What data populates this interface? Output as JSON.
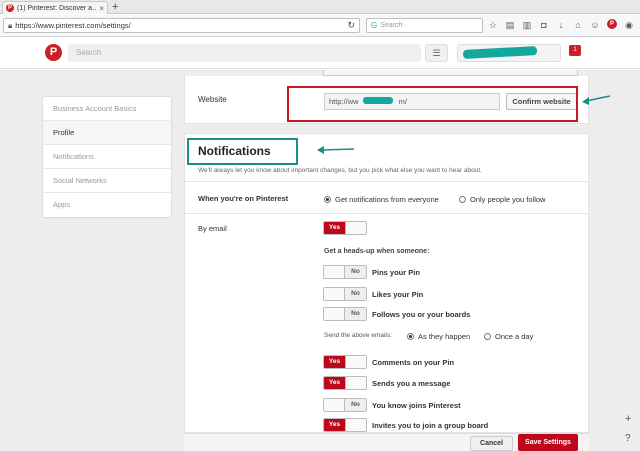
{
  "browser": {
    "tab_title": "(1) Pinterest: Discover a…",
    "tab_close": "×",
    "new_tab": "+",
    "url": "https://www.pinterest.com/settings/",
    "search_placeholder": "Search",
    "search_engine_icon": "G"
  },
  "header": {
    "logo": "P",
    "search_placeholder": "Search",
    "menu_icon": "☰",
    "notification_count": "1"
  },
  "sidebar": {
    "items": [
      {
        "label": "Business Account Basics"
      },
      {
        "label": "Profile"
      },
      {
        "label": "Notifications"
      },
      {
        "label": "Social Networks"
      },
      {
        "label": "Apps"
      }
    ]
  },
  "website": {
    "label": "Website",
    "value_prefix": "http://ww",
    "value_suffix": "m/",
    "confirm_button": "Confirm website"
  },
  "notifications": {
    "title": "Notifications",
    "subtitle": "We'll always let you know about important changes, but you pick what else you want to hear about.",
    "on_pinterest": {
      "label": "When you're on Pinterest",
      "option1": "Get notifications from everyone",
      "option2": "Only people you follow"
    },
    "by_email": {
      "label": "By email",
      "toggle": "Yes",
      "heads_up": "Get a heads-up when someone:",
      "items": [
        {
          "state": "No",
          "label": "Pins your Pin"
        },
        {
          "state": "No",
          "label": "Likes your Pin"
        },
        {
          "state": "No",
          "label": "Follows you or your boards"
        }
      ],
      "send_label": "Send the above emails:",
      "send_option1": "As they happen",
      "send_option2": "Once a day",
      "more_items": [
        {
          "state": "Yes",
          "label": "Comments on your Pin"
        },
        {
          "state": "Yes",
          "label": "Sends you a message"
        },
        {
          "state": "No",
          "label": "You know joins Pinterest"
        },
        {
          "state": "Yes",
          "label": "Invites you to join a group board"
        }
      ]
    }
  },
  "footer": {
    "cancel": "Cancel",
    "save": "Save Settings"
  },
  "zoom": {
    "plus": "+",
    "help": "?"
  },
  "colors": {
    "pinterest_red": "#bd081c",
    "annotation_red": "#c8171e",
    "annotation_teal": "#1a8d85"
  }
}
